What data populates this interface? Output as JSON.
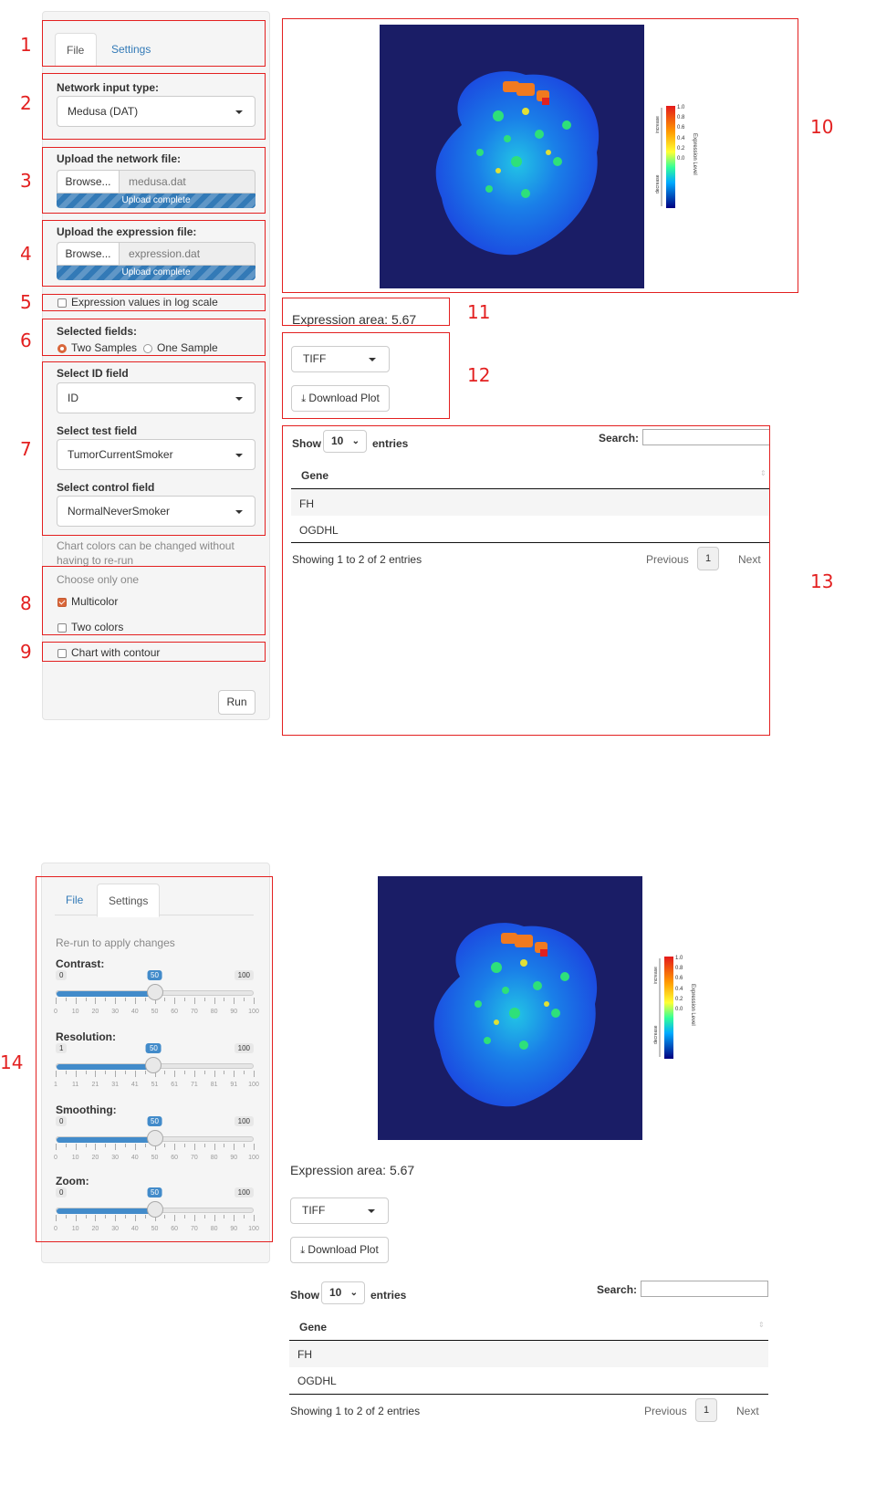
{
  "top": {
    "tabs": {
      "file": "File",
      "settings": "Settings"
    },
    "network_input": {
      "label": "Network input type:",
      "value": "Medusa (DAT)"
    },
    "network_file": {
      "label": "Upload the network file:",
      "browse": "Browse...",
      "filename": "medusa.dat",
      "progress_text": "Upload complete",
      "progress": 1.0
    },
    "expression_file": {
      "label": "Upload the expression file:",
      "browse": "Browse...",
      "filename": "expression.dat",
      "progress_text": "Upload complete",
      "progress": 1.0
    },
    "log_scale": {
      "label": "Expression values in log scale",
      "checked": false
    },
    "selected_fields": {
      "label": "Selected fields:",
      "opt1": "Two Samples",
      "opt2": "One Sample",
      "selected": "Two Samples"
    },
    "id_field": {
      "label": "Select ID field",
      "value": "ID"
    },
    "test_field": {
      "label": "Select test field",
      "value": "TumorCurrentSmoker"
    },
    "control_field": {
      "label": "Select control field",
      "value": "NormalNeverSmoker"
    },
    "color_note": "Chart colors can be changed without having to re-run",
    "choose_one": "Choose only one",
    "multicolor": {
      "label": "Multicolor",
      "checked": true
    },
    "two_colors": {
      "label": "Two colors",
      "checked": false
    },
    "contour": {
      "label": "Chart with contour",
      "checked": false
    },
    "run_button": "Run",
    "expression_area": "Expression area: 5.67",
    "format_select": "TIFF",
    "download_button": "Download Plot",
    "table": {
      "show": "Show",
      "entries_value": "10",
      "entries": "entries",
      "search_label": "Search:",
      "column": "Gene",
      "rows": [
        "FH",
        "OGDHL"
      ],
      "info": "Showing 1 to 2 of 2 entries",
      "prev": "Previous",
      "page": "1",
      "next": "Next"
    },
    "colorbar": {
      "title": "Expression Level",
      "increase": "increase",
      "decrease": "decrease",
      "ticks": [
        "1.0",
        "0.8",
        "0.6",
        "0.4",
        "0.2",
        "0.0"
      ]
    }
  },
  "annotations": [
    "1",
    "2",
    "3",
    "4",
    "5",
    "6",
    "7",
    "8",
    "9",
    "10",
    "11",
    "12",
    "13",
    "14"
  ],
  "bottom": {
    "tabs": {
      "file": "File",
      "settings": "Settings"
    },
    "note": "Re-run to apply changes",
    "sliders": [
      {
        "label": "Contrast:",
        "min": "0",
        "max": "100",
        "value": "50",
        "fraction": 0.5,
        "ticks": [
          "0",
          "10",
          "20",
          "30",
          "40",
          "50",
          "60",
          "70",
          "80",
          "90",
          "100"
        ]
      },
      {
        "label": "Resolution:",
        "min": "1",
        "max": "100",
        "value": "50",
        "fraction": 0.495,
        "ticks": [
          "1",
          "11",
          "21",
          "31",
          "41",
          "51",
          "61",
          "71",
          "81",
          "91",
          "100"
        ]
      },
      {
        "label": "Smoothing:",
        "min": "0",
        "max": "100",
        "value": "50",
        "fraction": 0.5,
        "ticks": [
          "0",
          "10",
          "20",
          "30",
          "40",
          "50",
          "60",
          "70",
          "80",
          "90",
          "100"
        ]
      },
      {
        "label": "Zoom:",
        "min": "0",
        "max": "100",
        "value": "50",
        "fraction": 0.5,
        "ticks": [
          "0",
          "10",
          "20",
          "30",
          "40",
          "50",
          "60",
          "70",
          "80",
          "90",
          "100"
        ]
      }
    ],
    "expression_area": "Expression area: 5.67",
    "format_select": "TIFF",
    "download_button": "Download Plot",
    "table": {
      "show": "Show",
      "entries_value": "10",
      "entries": "entries",
      "search_label": "Search:",
      "column": "Gene",
      "rows": [
        "FH",
        "OGDHL"
      ],
      "info": "Showing 1 to 2 of 2 entries",
      "prev": "Previous",
      "page": "1",
      "next": "Next"
    },
    "colorbar": {
      "title": "Expression Level",
      "increase": "increase",
      "decrease": "decrease",
      "ticks": [
        "1.0",
        "0.8",
        "0.6",
        "0.4",
        "0.2",
        "0.0"
      ]
    }
  },
  "colors": {
    "annotation": "#e32020",
    "link": "#337ab7",
    "accent": "#d9663a",
    "slider": "#428bca",
    "plot_bg": "#1a1d66"
  }
}
